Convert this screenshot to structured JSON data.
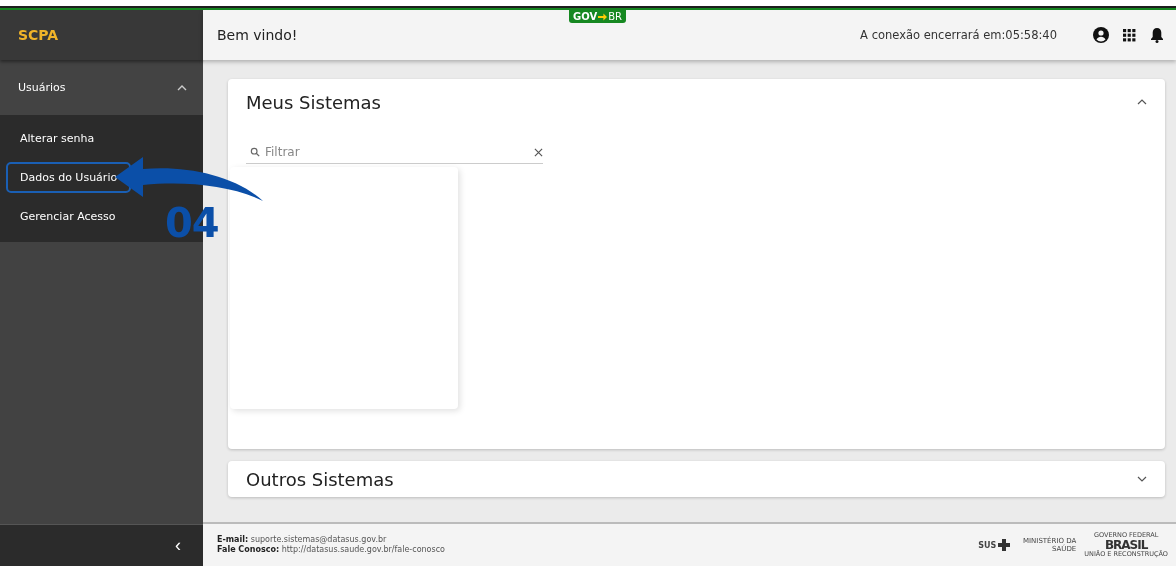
{
  "sidebar": {
    "title": "SCPA",
    "groups": [
      {
        "label": "Usuários",
        "expanded": true,
        "items": [
          {
            "label": "Alterar senha",
            "selected": false
          },
          {
            "label": "Dados do Usuário",
            "selected": true
          },
          {
            "label": "Gerenciar Acesso",
            "selected": false
          }
        ]
      }
    ],
    "collapse_button": "‹"
  },
  "header": {
    "greeting": "Bem vindo!",
    "badge": {
      "left": "GOV",
      "right": "BR"
    },
    "session": "A conexão encerrará em:05:58:40"
  },
  "cards": [
    {
      "title": "Meus Sistemas",
      "expanded": true,
      "filter": {
        "placeholder": "Filtrar"
      }
    },
    {
      "title": "Outros Sistemas",
      "expanded": false
    }
  ],
  "footer": {
    "lines": [
      {
        "label": "E-mail:",
        "value": "suporte.sistemas@datasus.gov.br"
      },
      {
        "label": "Fale Conosco:",
        "value": "http://datasus.saude.gov.br/fale-conosco"
      }
    ],
    "logos": {
      "sus": "SUS",
      "ministry": "MINISTÉRIO DA SAÚDE",
      "gov": "GOVERNO FEDERAL",
      "brasil": "BRASIL",
      "slogan": "UNIÃO E RECONSTRUÇÃO"
    }
  },
  "annotation": {
    "label": "04"
  }
}
